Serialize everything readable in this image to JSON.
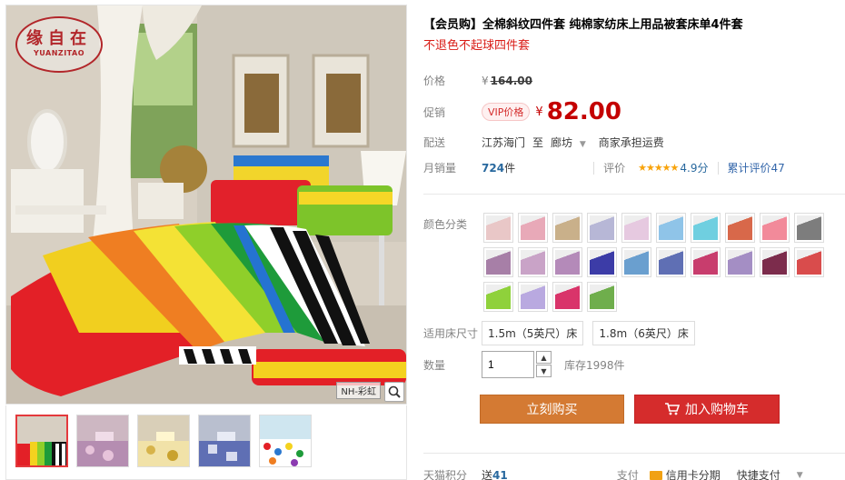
{
  "product": {
    "title": "【会员购】全棉斜纹四件套 纯棉家纺床上用品被套床单4件套",
    "subtitle": "不退色不起球四件套"
  },
  "gallery": {
    "logo_cn": "缘自在",
    "logo_en": "YUANZITAO",
    "watermark": "NH-彩虹"
  },
  "price": {
    "label": "价格",
    "original_currency": "¥",
    "original": "164.00"
  },
  "promo": {
    "label": "促销",
    "badge": "VIP价格",
    "currency": "¥",
    "price": "82.00"
  },
  "delivery": {
    "label": "配送",
    "from": "江苏海门",
    "to_word": "至",
    "to": "廊坊",
    "note": "商家承担运费"
  },
  "sales": {
    "label": "月销量",
    "count": "724",
    "unit": "件",
    "rating_label": "评价",
    "stars": "★★★★★",
    "score": "4.9分",
    "total_label": "累计评价",
    "total": "47"
  },
  "color": {
    "label": "颜色分类",
    "swatches": [
      "#e9c7c7",
      "#e8a9b8",
      "#c9b08a",
      "#b7b7d6",
      "#e6c9e0",
      "#8fc4e8",
      "#6fcfe0",
      "#d8684a",
      "#f28a9a",
      "#7d7d7d",
      "#a77fa7",
      "#c9a3c7",
      "#b48ab9",
      "#3c3ca7",
      "#6a9fcf",
      "#5f6fb4",
      "#c83d6d",
      "#a48ec4",
      "#7c2c4c",
      "#d94c4c",
      "#8fd13b",
      "#b9a9e0",
      "#d9346a",
      "#6fae4c"
    ]
  },
  "size": {
    "label": "适用床尺寸",
    "options": [
      "1.5m（5英尺）床",
      "1.8m（6英尺）床"
    ]
  },
  "quantity": {
    "label": "数量",
    "value": "1",
    "stock": "库存1998件"
  },
  "actions": {
    "buy": "立刻购买",
    "cart": "加入购物车"
  },
  "footer": {
    "points_label": "天猫积分",
    "points_prefix": "送",
    "points": "41",
    "pay_label": "支付",
    "pay_card": "信用卡分期",
    "pay_fast": "快捷支付"
  }
}
